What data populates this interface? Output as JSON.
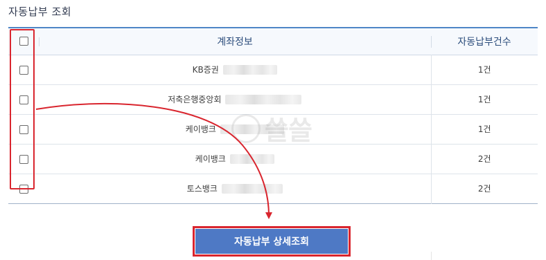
{
  "section": {
    "title": "자동납부 조회"
  },
  "table": {
    "headers": {
      "account": "계좌정보",
      "count": "자동납부건수"
    },
    "rows": [
      {
        "bank": "KB증권",
        "count": "1건"
      },
      {
        "bank": "저축은행중앙회",
        "count": "1건"
      },
      {
        "bank": "케이뱅크",
        "count": "1건"
      },
      {
        "bank": "케이뱅크",
        "count": "2건"
      },
      {
        "bank": "토스뱅크",
        "count": "2건"
      }
    ]
  },
  "actions": {
    "detail_button_label": "자동납부 상세조회"
  },
  "watermark": {
    "text": "쓸쓸"
  },
  "colors": {
    "accent": "#4e79c5",
    "highlight": "#d9252e",
    "header_text": "#2c4d7c"
  }
}
